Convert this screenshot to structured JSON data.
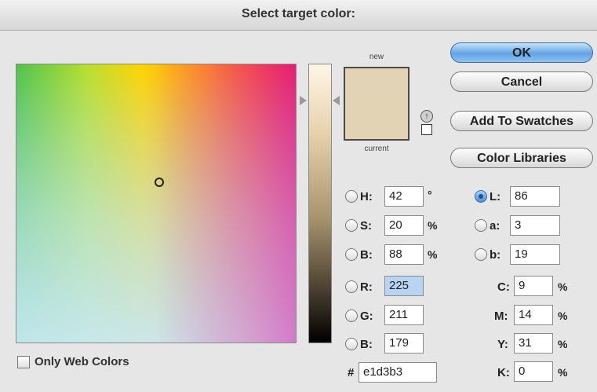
{
  "window": {
    "title": "Select target color:"
  },
  "picker": {
    "new_label": "new",
    "current_label": "current",
    "new_color": "#e1d3b3",
    "current_color": "#e1d3b3"
  },
  "buttons": {
    "ok": "OK",
    "cancel": "Cancel",
    "add_to_swatches": "Add To Swatches",
    "color_libraries": "Color Libraries"
  },
  "hsb": {
    "h": {
      "label": "H:",
      "value": "42",
      "unit": "°"
    },
    "s": {
      "label": "S:",
      "value": "20",
      "unit": "%"
    },
    "b": {
      "label": "B:",
      "value": "88",
      "unit": "%"
    }
  },
  "rgb": {
    "r": {
      "label": "R:",
      "value": "225"
    },
    "g": {
      "label": "G:",
      "value": "211"
    },
    "b": {
      "label": "B:",
      "value": "179"
    }
  },
  "lab": {
    "l": {
      "label": "L:",
      "value": "86"
    },
    "a": {
      "label": "a:",
      "value": "3"
    },
    "b": {
      "label": "b:",
      "value": "19"
    }
  },
  "cmyk": {
    "c": {
      "label": "C:",
      "value": "9",
      "unit": "%"
    },
    "m": {
      "label": "M:",
      "value": "14",
      "unit": "%"
    },
    "y": {
      "label": "Y:",
      "value": "31",
      "unit": "%"
    },
    "k": {
      "label": "K:",
      "value": "0",
      "unit": "%"
    }
  },
  "hex": {
    "label": "#",
    "value": "e1d3b3"
  },
  "web_only": {
    "label": "Only Web Colors",
    "checked": false
  },
  "icons": {
    "gamut_warning": "gamut-warning-icon",
    "web_safe": "web-safe-cube-icon",
    "field_marker": "color-marker-icon"
  }
}
